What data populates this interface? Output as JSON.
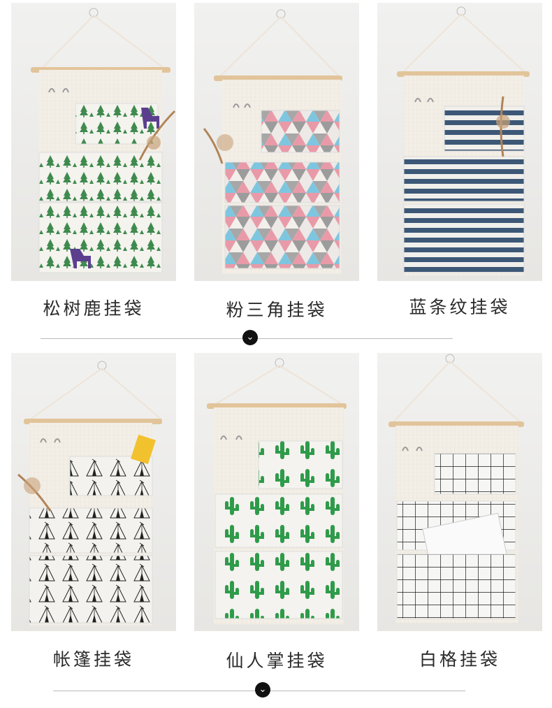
{
  "products": [
    {
      "name": "松树鹿挂袋",
      "pattern": "pine-tree-deer",
      "accent": "#3f8a4e"
    },
    {
      "name": "粉三角挂袋",
      "pattern": "pink-triangle",
      "accent": "#e99aa8"
    },
    {
      "name": "蓝条纹挂袋",
      "pattern": "blue-stripe",
      "accent": "#3d5877"
    },
    {
      "name": "帐篷挂袋",
      "pattern": "tent",
      "accent": "#222222"
    },
    {
      "name": "仙人掌挂袋",
      "pattern": "cactus",
      "accent": "#2f9b4a"
    },
    {
      "name": "白格挂袋",
      "pattern": "white-grid",
      "accent": "#1b1b1b"
    }
  ],
  "icons": {
    "scroll": "chevron-down-icon"
  }
}
